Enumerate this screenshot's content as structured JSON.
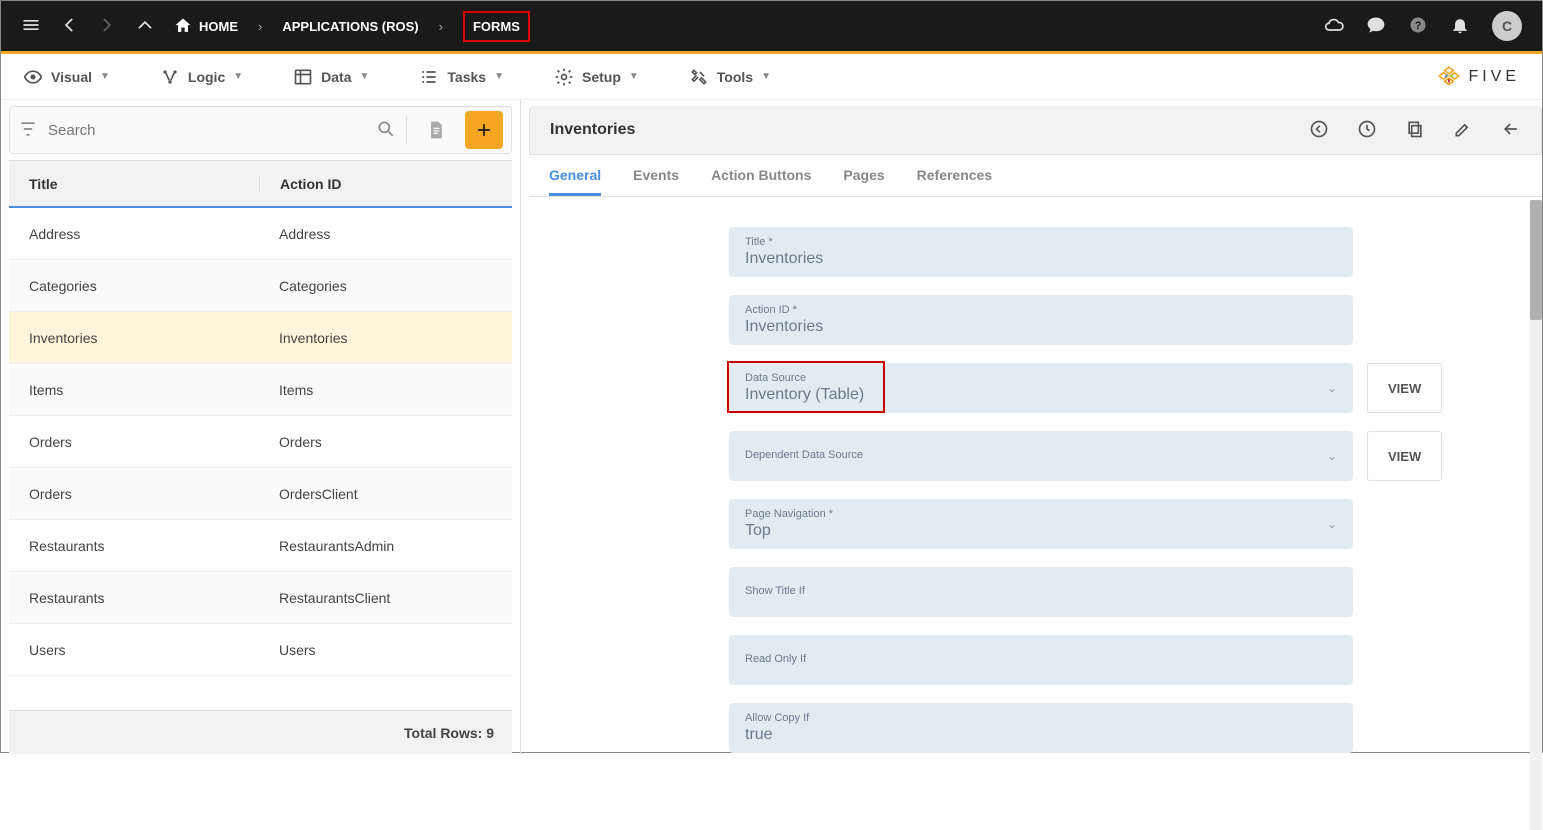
{
  "breadcrumb": {
    "home": "HOME",
    "apps": "APPLICATIONS (ROS)",
    "forms": "FORMS"
  },
  "avatar_initial": "C",
  "menus": {
    "visual": "Visual",
    "logic": "Logic",
    "data": "Data",
    "tasks": "Tasks",
    "setup": "Setup",
    "tools": "Tools"
  },
  "logo": "FIVE",
  "search_placeholder": "Search",
  "columns": {
    "title": "Title",
    "action_id": "Action ID"
  },
  "rows": [
    {
      "title": "Address",
      "action_id": "Address"
    },
    {
      "title": "Categories",
      "action_id": "Categories"
    },
    {
      "title": "Inventories",
      "action_id": "Inventories",
      "selected": true
    },
    {
      "title": "Items",
      "action_id": "Items"
    },
    {
      "title": "Orders",
      "action_id": "Orders"
    },
    {
      "title": "Orders",
      "action_id": "OrdersClient"
    },
    {
      "title": "Restaurants",
      "action_id": "RestaurantsAdmin"
    },
    {
      "title": "Restaurants",
      "action_id": "RestaurantsClient"
    },
    {
      "title": "Users",
      "action_id": "Users"
    }
  ],
  "total_rows_label": "Total Rows: 9",
  "detail": {
    "title": "Inventories"
  },
  "tabs": {
    "general": "General",
    "events": "Events",
    "action_buttons": "Action Buttons",
    "pages": "Pages",
    "references": "References"
  },
  "fields": {
    "title": {
      "label": "Title *",
      "value": "Inventories"
    },
    "action_id": {
      "label": "Action ID *",
      "value": "Inventories"
    },
    "data_source": {
      "label": "Data Source",
      "value": "Inventory (Table)"
    },
    "dependent": {
      "label": "Dependent Data Source",
      "value": ""
    },
    "page_nav": {
      "label": "Page Navigation *",
      "value": "Top"
    },
    "show_title_if": {
      "label": "Show Title If",
      "value": ""
    },
    "read_only_if": {
      "label": "Read Only If",
      "value": ""
    },
    "allow_copy_if": {
      "label": "Allow Copy If",
      "value": "true"
    }
  },
  "view_btn": "VIEW"
}
